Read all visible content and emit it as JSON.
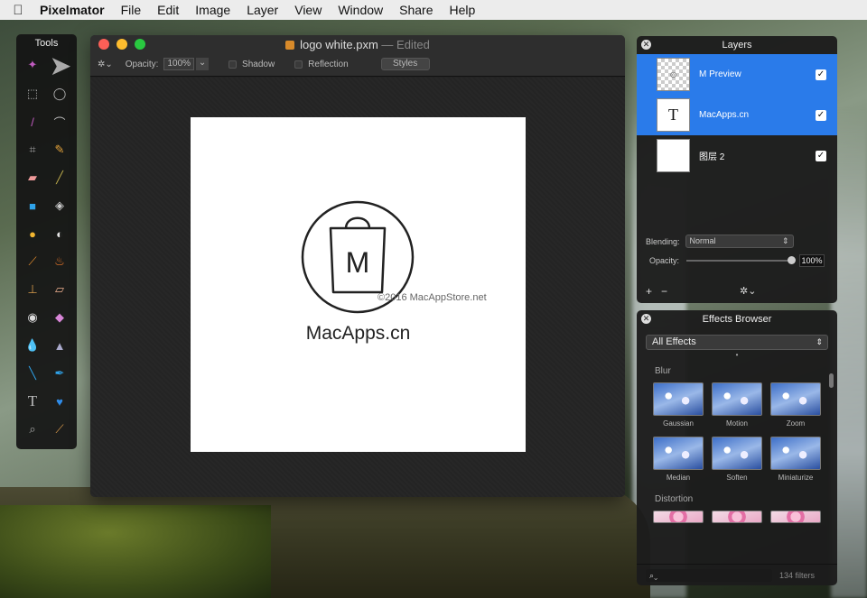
{
  "menubar": {
    "app_name": "Pixelmator",
    "items": [
      "File",
      "Edit",
      "Image",
      "Layer",
      "View",
      "Window",
      "Share",
      "Help"
    ]
  },
  "tools": {
    "title": "Tools",
    "icons": [
      "cursor-icon",
      "magic-wand-icon",
      "rect-marquee-icon",
      "ellipse-marquee-icon",
      "brush-select-icon",
      "lasso-icon",
      "crop-icon",
      "pencil-icon",
      "eraser-icon",
      "line-icon",
      "rectangle-shape-icon",
      "paint-bucket-icon",
      "gradient-icon",
      "color-picker-icon",
      "sponge-icon",
      "burn-icon",
      "clone-stamp-icon",
      "bandage-icon",
      "red-eye-icon",
      "light-eraser-icon",
      "blur-drop-icon",
      "sharpen-icon",
      "pen-icon",
      "freeform-pen-icon",
      "type-icon",
      "heart-shape-icon",
      "zoom-icon",
      "eyedropper-icon"
    ]
  },
  "document": {
    "title": "logo white.pxm",
    "status": "— Edited",
    "opacity_label": "Opacity:",
    "opacity_value": "100%",
    "shadow_label": "Shadow",
    "reflection_label": "Reflection",
    "styles_label": "Styles",
    "canvas_text": "MacApps.cn",
    "watermark": "©2016 MacAppStore.net",
    "logo_letter": "M"
  },
  "layers": {
    "title": "Layers",
    "rows": [
      {
        "name": "M Preview",
        "selected": true,
        "thumb": ""
      },
      {
        "name": "MacApps.cn",
        "selected": true,
        "thumb": "T"
      },
      {
        "name": "图层 2",
        "selected": false,
        "thumb": ""
      }
    ],
    "blending_label": "Blending:",
    "blending_value": "Normal",
    "opacity_label": "Opacity:",
    "opacity_value": "100%",
    "add_label": "+",
    "remove_label": "−"
  },
  "effects": {
    "title": "Effects Browser",
    "category": "All Effects",
    "groups": [
      {
        "name": "Blur",
        "items": [
          "Gaussian",
          "Motion",
          "Zoom",
          "Median",
          "Soften",
          "Miniaturize"
        ]
      },
      {
        "name": "Distortion",
        "items": []
      }
    ],
    "count": "134 filters"
  },
  "colors": {
    "accent": "#2a7bea",
    "close_red": "#fc5f57",
    "minimize_yellow": "#fdbc2e",
    "zoom_green": "#29c840"
  }
}
